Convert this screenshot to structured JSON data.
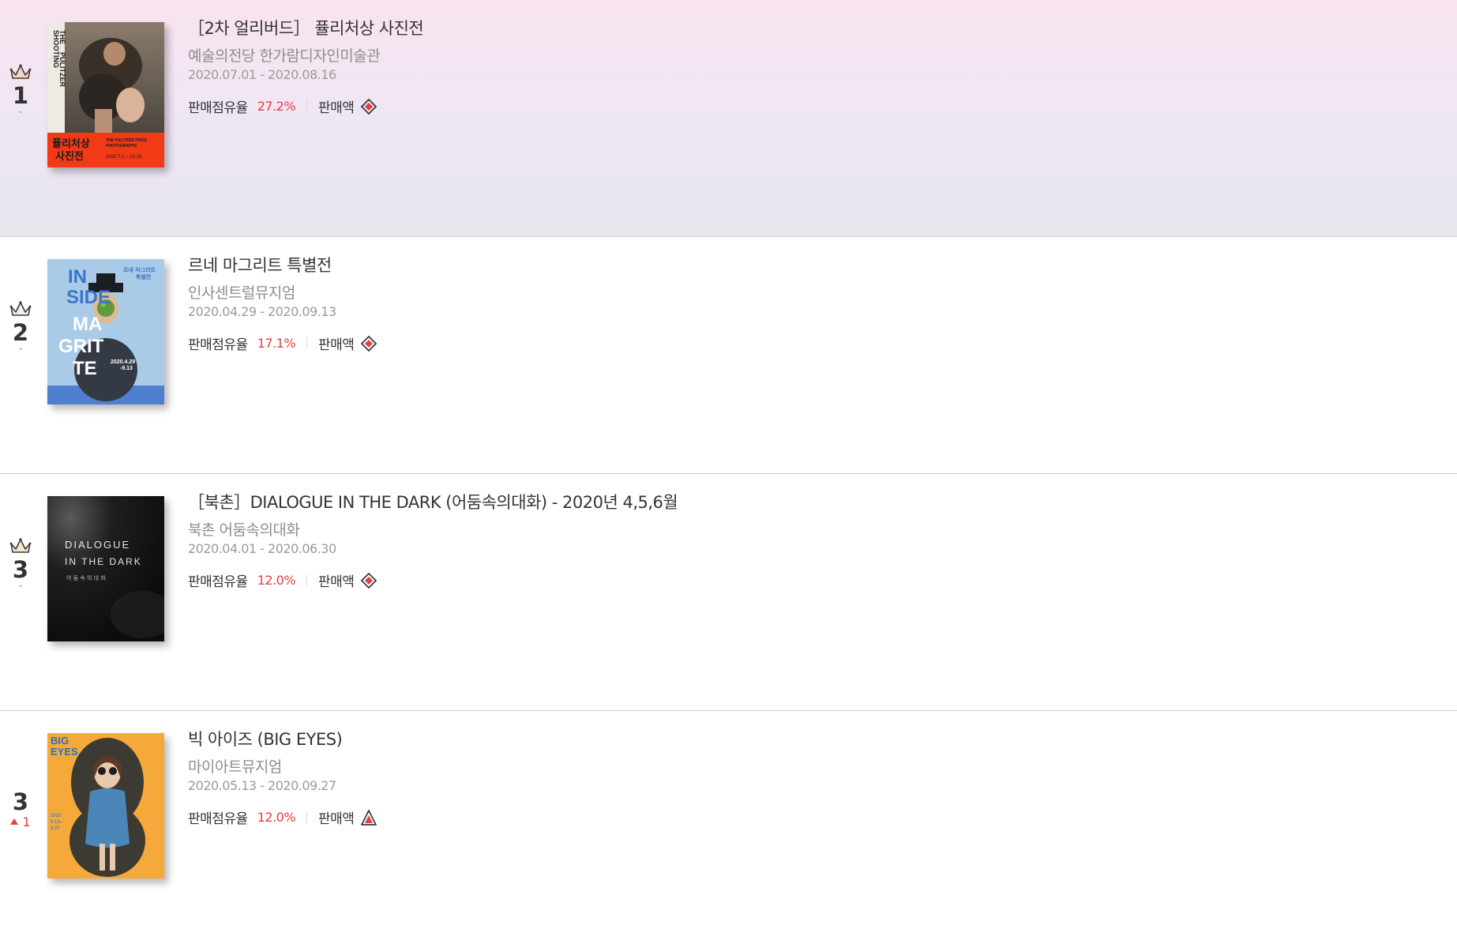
{
  "ranking": [
    {
      "rank": "1",
      "change": "-",
      "change_type": "same",
      "crown": true,
      "title": "［2차 얼리버드］ 퓰리처상 사진전",
      "venue": "예술의전당 한가람디자인미술관",
      "period": "2020.07.01  - 2020.08.16",
      "share_label": "판매점유율",
      "share_value": "27.2%",
      "sales_label": "판매액",
      "sales_icon": "diamond-grade-icon",
      "poster": {
        "top_text_1": "SHOOTING",
        "top_text_2": "THE",
        "top_text_3": "PULITZER",
        "ko_title_1": "퓰리처상",
        "ko_title_2": "사진전",
        "en_title_1": "THE PULITZER PRIZE",
        "en_title_2": "PHOTOGRAPHS",
        "dates": "2020.7.1 – 10.18"
      }
    },
    {
      "rank": "2",
      "change": "-",
      "change_type": "same",
      "crown": true,
      "title": "르네 마그리트 특별전",
      "venue": "인사센트럴뮤지엄",
      "period": "2020.04.29  - 2020.09.13",
      "share_label": "판매점유율",
      "share_value": "17.1%",
      "sales_label": "판매액",
      "sales_icon": "diamond-grade-icon",
      "poster": {
        "ko_title_1": "르네 마그리트",
        "ko_title_2": "특별전",
        "l1": "IN",
        "l2": "SIDE",
        "l3": "MA",
        "l4": "GRIT",
        "l5": "TE",
        "dates_1": "2020.4.29",
        "dates_2": "-9.13"
      }
    },
    {
      "rank": "3",
      "change": "-",
      "change_type": "same",
      "crown": true,
      "title": "［북촌］DIALOGUE IN THE DARK (어둠속의대화) - 2020년 4,5,6월",
      "venue": "북촌 어둠속의대화",
      "period": "2020.04.01  - 2020.06.30",
      "share_label": "판매점유율",
      "share_value": "12.0%",
      "sales_label": "판매액",
      "sales_icon": "diamond-grade-icon",
      "poster": {
        "line1": "DIALOGUE",
        "line2": "IN THE DARK",
        "line3": "어 둠 속 의 대 화"
      }
    },
    {
      "rank": "3",
      "change": "1",
      "change_type": "up",
      "crown": false,
      "title": "빅 아이즈 (BIG EYES)",
      "venue": "마이아트뮤지엄",
      "period": "2020.05.13  - 2020.09.27",
      "share_label": "판매점유율",
      "share_value": "12.0%",
      "sales_label": "판매액",
      "sales_icon": "triangle-grade-icon",
      "poster": {
        "l1": "BIG",
        "l2": "EYES",
        "dates_1": "2020",
        "dates_2": "5.13–",
        "dates_3": "9.27"
      }
    }
  ],
  "colors": {
    "accent": "#e4403f",
    "text": "#333333",
    "muted": "#8d8d8d"
  }
}
